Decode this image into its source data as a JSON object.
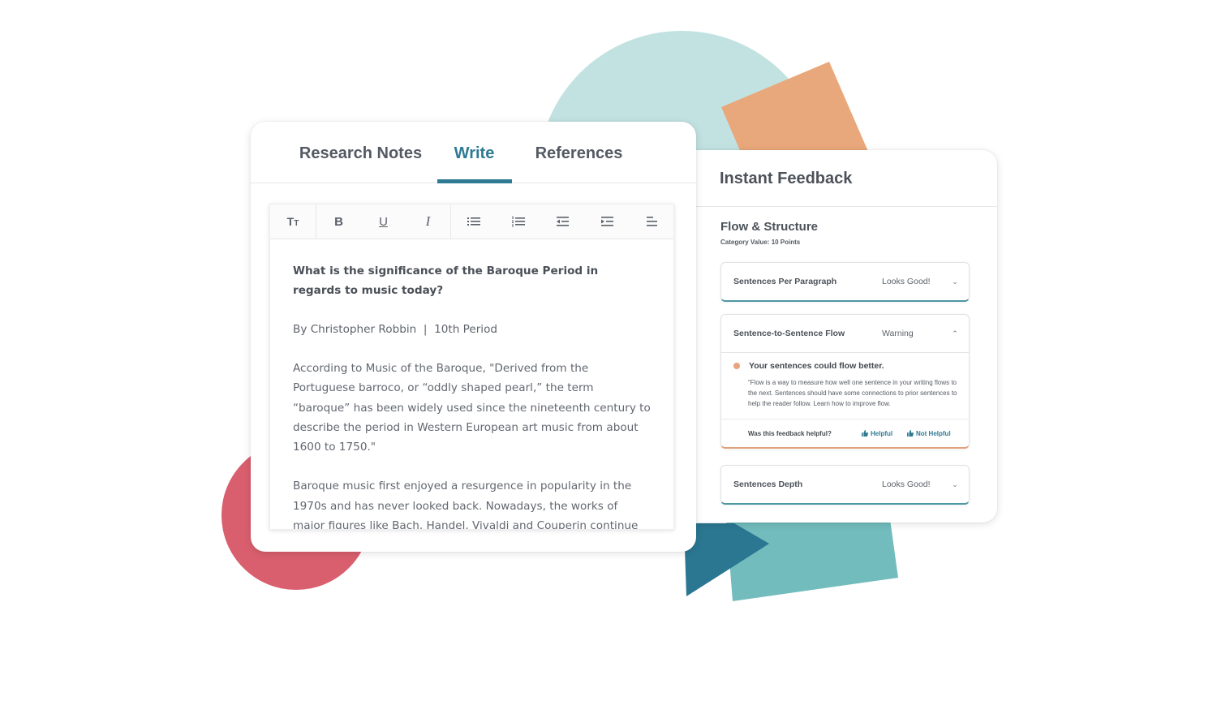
{
  "colors": {
    "accent": "#2e7a93",
    "circle_teal": "#c2e2e2",
    "square_orange": "#e9a87b",
    "circle_red": "#d95f6e",
    "triangle_dark": "#2b7791",
    "rect_teal": "#72bcbd",
    "warning_dot": "#e8a47a"
  },
  "editor": {
    "tabs": [
      {
        "label": "Research Notes",
        "active": false
      },
      {
        "label": "Write",
        "active": true
      },
      {
        "label": "References",
        "active": false
      }
    ],
    "toolbar": {
      "text_size": "Tт",
      "bold": "B",
      "underline": "U",
      "italic": "I"
    },
    "document": {
      "title": "What is the significance of the Baroque Period in regards to music today?",
      "byline": "By Christopher Robbin  |  10th Period",
      "paragraphs": [
        "According to Music of the Baroque, \"Derived from the Portuguese barroco, or “oddly shaped pearl,” the term “baroque” has been widely used since the nineteenth century to describe the period in Western European art music from about 1600 to 1750.\"",
        "Baroque music first enjoyed a resurgence in popularity in the 1970s and has never looked back. Nowadays, the works of major figures like Bach, Handel, Vivaldi and Couperin continue to be in the public eye, as"
      ]
    }
  },
  "feedback": {
    "title": "Instant Feedback",
    "section_title": "Flow & Structure",
    "section_subtitle": "Category Value: 10 Points",
    "cards": [
      {
        "name": "Sentences Per Paragraph",
        "status": "Looks Good!",
        "expanded": false
      },
      {
        "name": "Sentence-to-Sentence Flow",
        "status": "Warning",
        "expanded": true,
        "message_title": "Your sentences could flow better.",
        "message_text": "“Flow is a way to measure how well one sentence in your writing flows to the next. Sentences should have some connections to prior sentences to help the reader follow. Learn how to improve flow.",
        "helpful_question": "Was this feedback helpful?",
        "helpful_label": "Helpful",
        "not_helpful_label": "Not Helpful"
      },
      {
        "name": "Sentences Depth",
        "status": "Looks Good!",
        "expanded": false
      }
    ],
    "chevron_down": "⌄",
    "chevron_up": "⌃"
  }
}
